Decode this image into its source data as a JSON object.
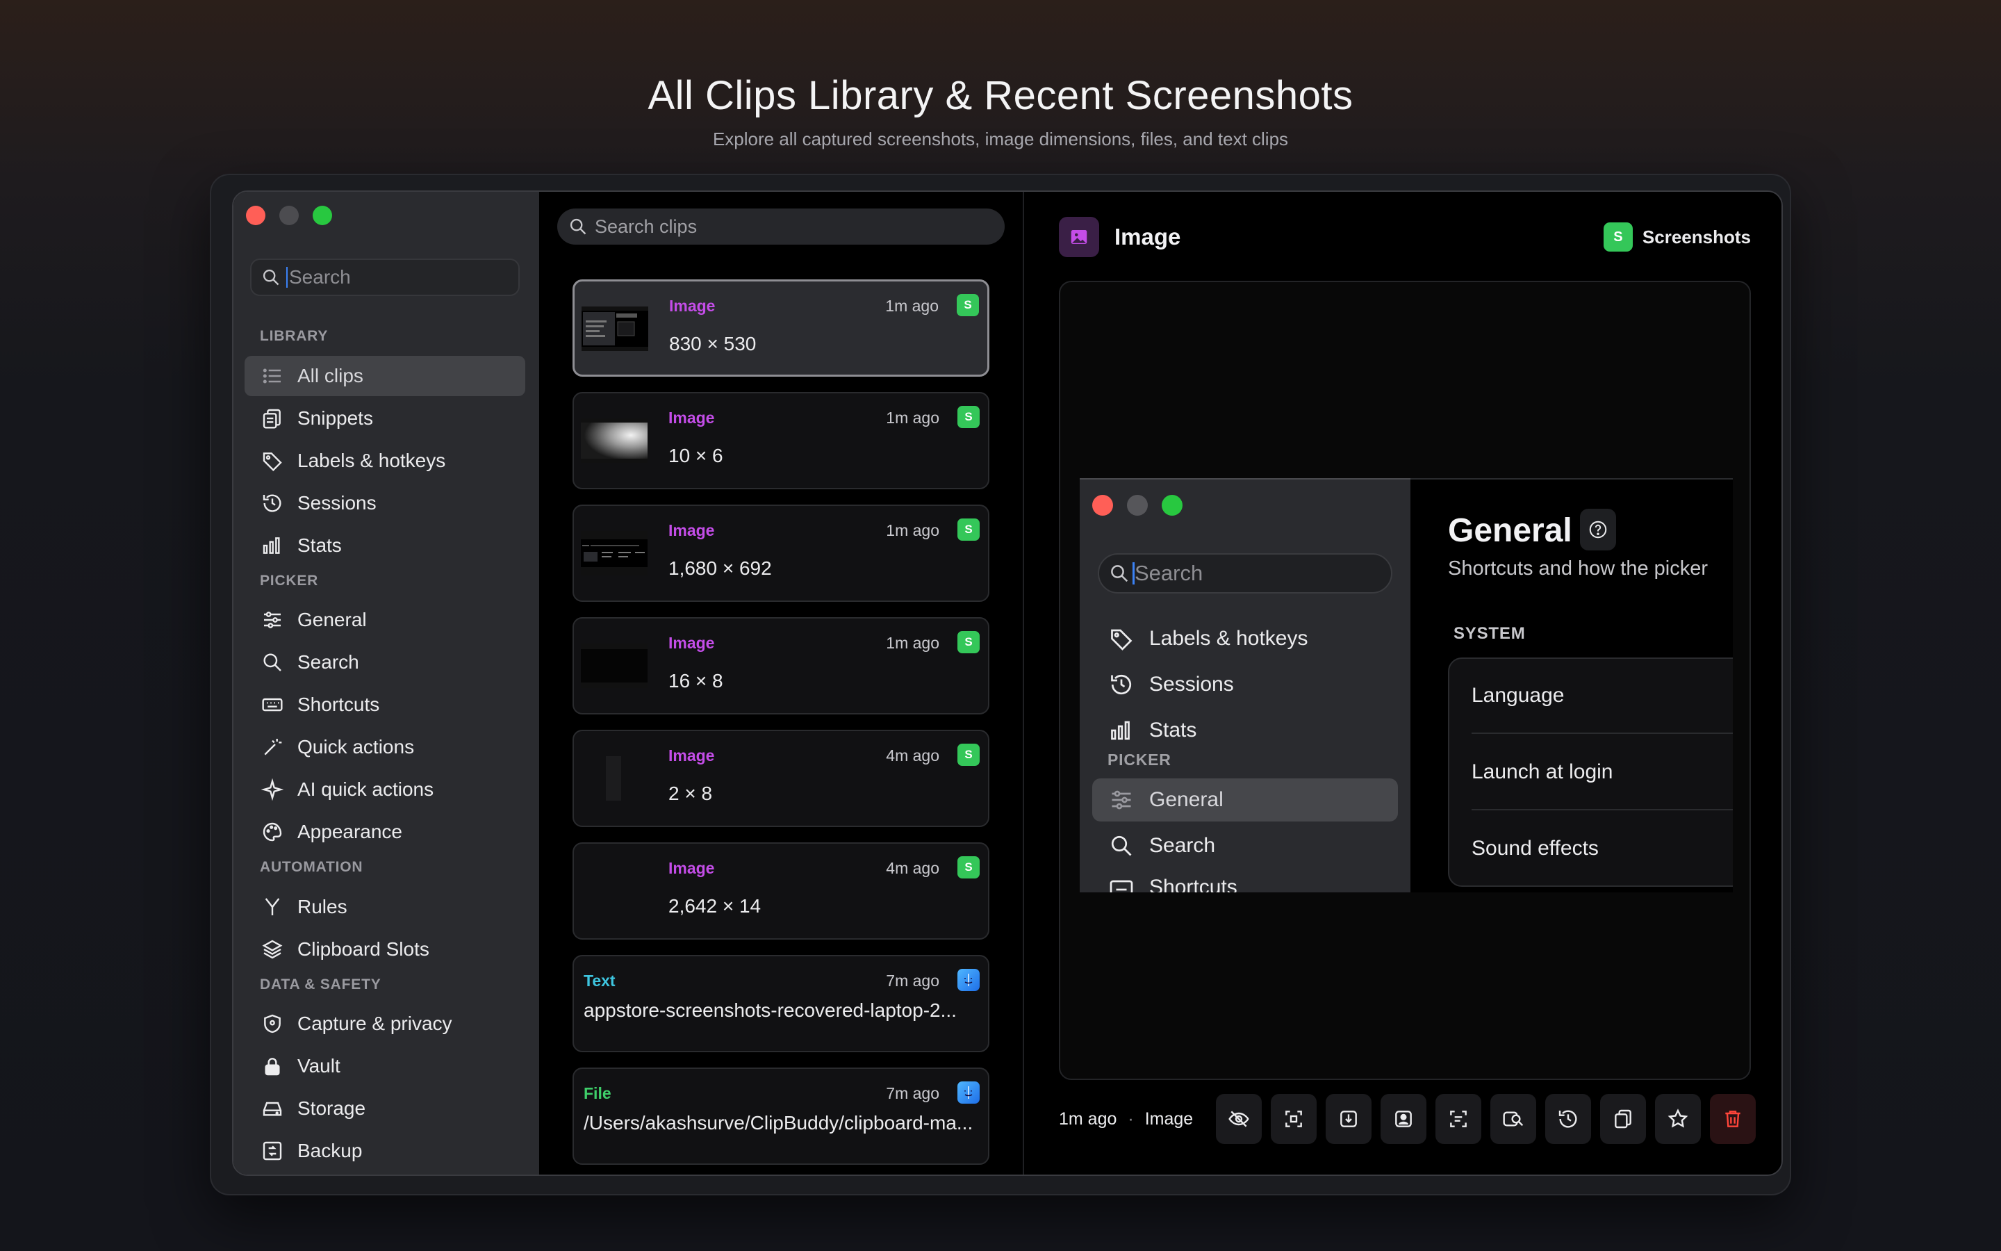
{
  "page": {
    "title": "All Clips Library & Recent Screenshots",
    "subtitle": "Explore all captured screenshots, image dimensions, files, and text clips"
  },
  "sidebar": {
    "search_placeholder": "Search",
    "sections": {
      "library": "LIBRARY",
      "picker": "PICKER",
      "automation": "AUTOMATION",
      "data_safety": "DATA & SAFETY"
    },
    "items": [
      {
        "label": "All clips",
        "icon": "list-icon",
        "selected": true
      },
      {
        "label": "Snippets",
        "icon": "snippets-icon"
      },
      {
        "label": "Labels & hotkeys",
        "icon": "tag-icon"
      },
      {
        "label": "Sessions",
        "icon": "history-icon"
      },
      {
        "label": "Stats",
        "icon": "stats-icon"
      },
      {
        "label": "General",
        "icon": "sliders-icon"
      },
      {
        "label": "Search",
        "icon": "search-icon"
      },
      {
        "label": "Shortcuts",
        "icon": "keyboard-icon"
      },
      {
        "label": "Quick actions",
        "icon": "wand-icon"
      },
      {
        "label": "AI quick actions",
        "icon": "sparkle-icon"
      },
      {
        "label": "Appearance",
        "icon": "palette-icon"
      },
      {
        "label": "Rules",
        "icon": "branch-icon"
      },
      {
        "label": "Clipboard Slots",
        "icon": "layers-icon"
      },
      {
        "label": "Capture & privacy",
        "icon": "shield-icon"
      },
      {
        "label": "Vault",
        "icon": "lock-icon"
      },
      {
        "label": "Storage",
        "icon": "drive-icon"
      },
      {
        "label": "Backup",
        "icon": "backup-icon"
      }
    ]
  },
  "clips": {
    "search_placeholder": "Search clips",
    "items": [
      {
        "type": "Image",
        "time": "1m ago",
        "value": "830 × 530",
        "badge": "S"
      },
      {
        "type": "Image",
        "time": "1m ago",
        "value": "10 × 6",
        "badge": "S"
      },
      {
        "type": "Image",
        "time": "1m ago",
        "value": "1,680 × 692",
        "badge": "S"
      },
      {
        "type": "Image",
        "time": "1m ago",
        "value": "16 × 8",
        "badge": "S"
      },
      {
        "type": "Image",
        "time": "4m ago",
        "value": "2 × 8",
        "badge": "S"
      },
      {
        "type": "Image",
        "time": "4m ago",
        "value": "2,642 × 14",
        "badge": "S"
      },
      {
        "type": "Text",
        "time": "7m ago",
        "value": "appstore-screenshots-recovered-laptop-2...",
        "badge": "finder"
      },
      {
        "type": "File",
        "time": "7m ago",
        "value": "/Users/akashsurve/ClipBuddy/clipboard-ma...",
        "badge": "finder"
      }
    ]
  },
  "detail": {
    "title": "Image",
    "app_name": "Screenshots",
    "app_badge": "S",
    "footer_time": "1m ago",
    "footer_dot": "·",
    "footer_type": "Image",
    "actions": [
      "hide-icon",
      "scan-icon",
      "save-icon",
      "person-icon",
      "ocr-icon",
      "lookup-icon",
      "history-icon",
      "copy-icon",
      "star-icon",
      "trash-icon"
    ],
    "preview": {
      "search_placeholder": "Search",
      "items": [
        "Labels & hotkeys",
        "Sessions",
        "Stats",
        "General",
        "Search",
        "Shortcuts"
      ],
      "section": "PICKER",
      "title": "General",
      "subtitle": "Shortcuts and how the picker",
      "system_section": "SYSTEM",
      "rows": [
        "Language",
        "Launch at login",
        "Sound effects"
      ]
    }
  },
  "colors": {
    "image_type": "#c44de8",
    "text_type": "#3ec6e0",
    "file_type": "#3fcf6a",
    "app_badge": "#34c759",
    "close": "#ff5f57",
    "zoom": "#28c840"
  }
}
